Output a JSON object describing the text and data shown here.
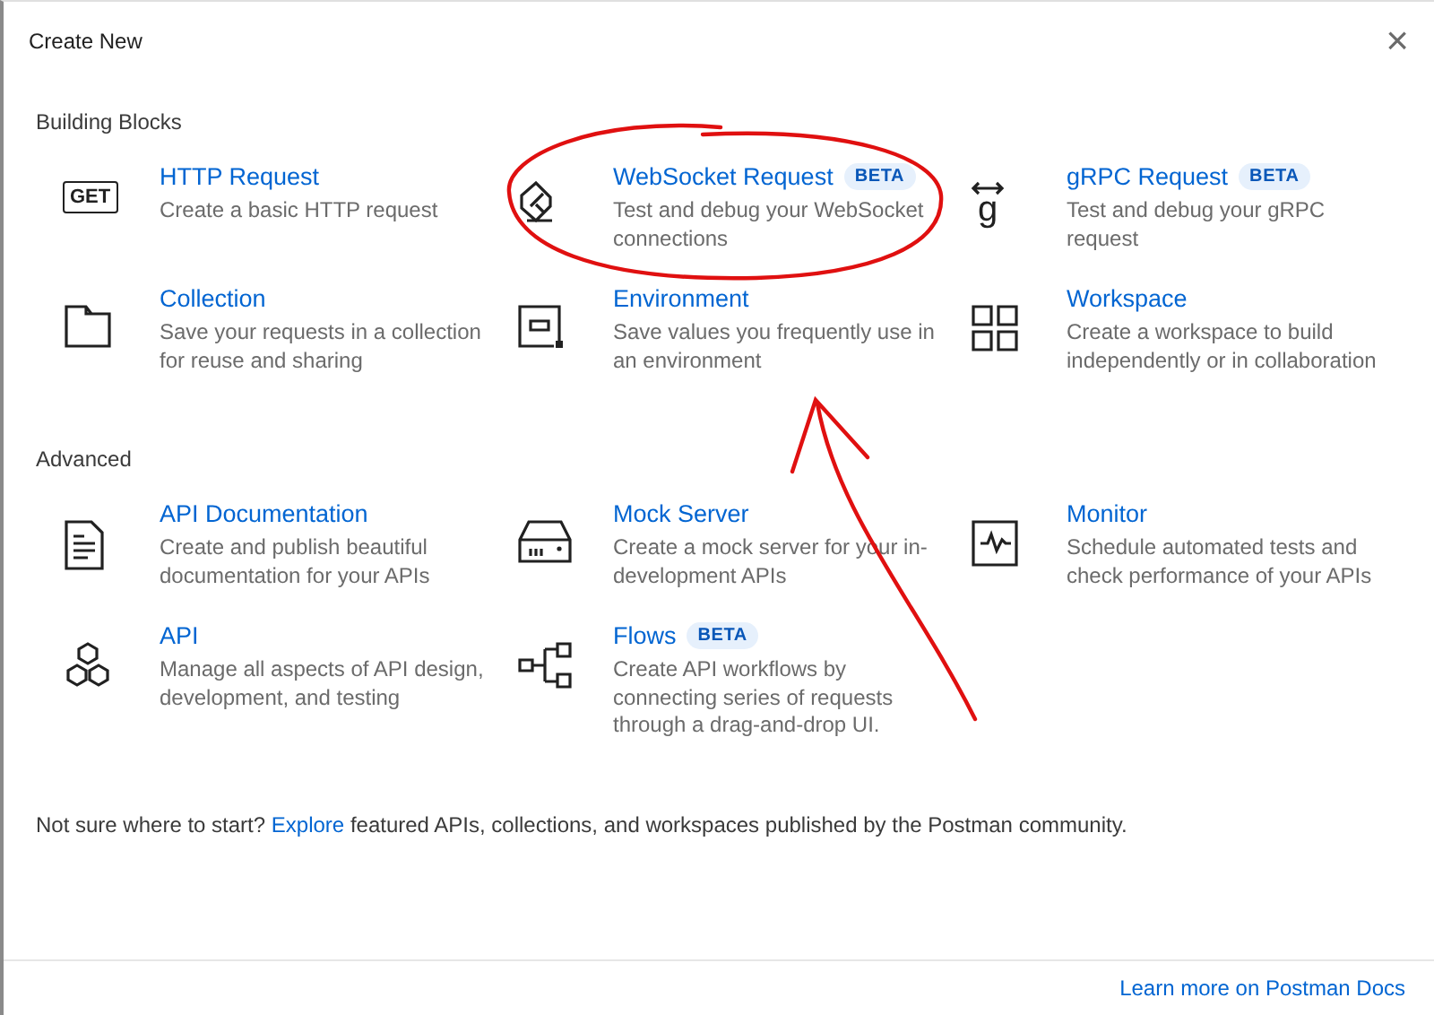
{
  "dialog": {
    "title": "Create New",
    "close": "×"
  },
  "sections": [
    {
      "title": "Building Blocks",
      "items": [
        {
          "kind": "get",
          "icon_text": "GET",
          "title": "HTTP Request",
          "description": "Create a basic HTTP request"
        },
        {
          "kind": "plug",
          "title": "WebSocket Request",
          "badge": "BETA",
          "description": "Test and debug your WebSocket connections"
        },
        {
          "kind": "grpc",
          "icon_text": "g",
          "title": "gRPC Request",
          "badge": "BETA",
          "description": "Test and debug your gRPC request"
        },
        {
          "kind": "folder",
          "title": "Collection",
          "description": "Save your requests in a collection for reuse and sharing"
        },
        {
          "kind": "env",
          "title": "Environment",
          "description": "Save values you frequently use in an environment"
        },
        {
          "kind": "grid",
          "title": "Workspace",
          "description": "Create a workspace to build independently or in collaboration"
        }
      ]
    },
    {
      "title": "Advanced",
      "items": [
        {
          "kind": "doc",
          "title": "API Documentation",
          "description": "Create and publish beautiful documentation for your APIs"
        },
        {
          "kind": "server",
          "title": "Mock Server",
          "description": "Create a mock server for your in-development APIs"
        },
        {
          "kind": "monitor",
          "title": "Monitor",
          "description": "Schedule automated tests and check performance of your APIs"
        },
        {
          "kind": "hex",
          "title": "API",
          "description": "Manage all aspects of API design, development, and testing"
        },
        {
          "kind": "flow",
          "title": "Flows",
          "badge": "BETA",
          "description": "Create API workflows by connecting series of requests through a drag-and-drop UI."
        }
      ]
    }
  ],
  "hint": {
    "before": "Not sure where to start?",
    "link": "Explore",
    "after": "featured APIs, collections, and workspaces published by the Postman community."
  },
  "footer": {
    "link": "Learn more on Postman Docs"
  }
}
